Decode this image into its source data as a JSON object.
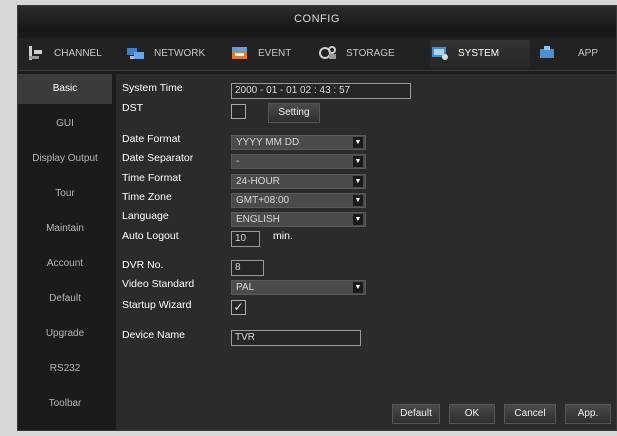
{
  "window": {
    "title": "CONFIG"
  },
  "tabs": [
    {
      "label": "CHANNEL",
      "icon": "channel-icon"
    },
    {
      "label": "NETWORK",
      "icon": "network-icon"
    },
    {
      "label": "EVENT",
      "icon": "event-icon"
    },
    {
      "label": "STORAGE",
      "icon": "storage-icon"
    },
    {
      "label": "SYSTEM",
      "icon": "system-icon",
      "active": true
    },
    {
      "label": "APP",
      "icon": "app-icon"
    }
  ],
  "sidebar": {
    "items": [
      "Basic",
      "GUI",
      "Display Output",
      "Tour",
      "Maintain",
      "Account",
      "Default",
      "Upgrade",
      "RS232",
      "Toolbar"
    ],
    "active": "Basic"
  },
  "form": {
    "system_time": {
      "label": "System Time",
      "value": "2000 - 01 - 01  02 : 43 : 57"
    },
    "dst": {
      "label": "DST",
      "setting_button": "Setting",
      "checked": false
    },
    "date_format": {
      "label": "Date Format",
      "value": "YYYY MM DD"
    },
    "date_separator": {
      "label": "Date Separator",
      "value": "-"
    },
    "time_format": {
      "label": "Time Format",
      "value": "24-HOUR"
    },
    "time_zone": {
      "label": "Time Zone",
      "value": "GMT+08:00"
    },
    "language": {
      "label": "Language",
      "value": "ENGLISH"
    },
    "auto_logout": {
      "label": "Auto Logout",
      "value": "10",
      "unit": "min."
    },
    "dvr_no": {
      "label": "DVR No.",
      "value": "8"
    },
    "video_standard": {
      "label": "Video Standard",
      "value": "PAL"
    },
    "startup_wizard": {
      "label": "Startup Wizard",
      "checked": true
    },
    "device_name": {
      "label": "Device Name",
      "value": "TVR"
    }
  },
  "footer": {
    "default": "Default",
    "ok": "OK",
    "cancel": "Cancel",
    "apply": "App."
  },
  "colors": {
    "window_bg": "#1b1b1b",
    "content_bg": "#2b2b2b",
    "active_side": "#3b3b3b"
  }
}
